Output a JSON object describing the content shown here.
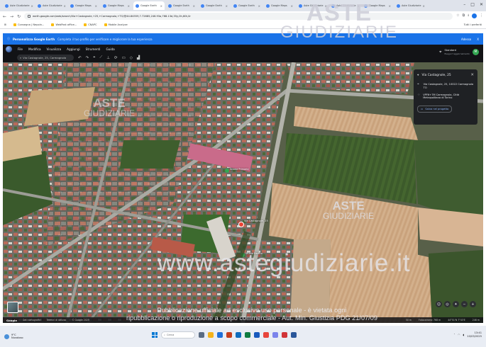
{
  "browser": {
    "tabs": [
      {
        "label": "Aste Giudiziarie",
        "active": false
      },
      {
        "label": "Aste Giudiziarie",
        "active": false
      },
      {
        "label": "Google Maps",
        "active": false
      },
      {
        "label": "Google Maps",
        "active": false
      },
      {
        "label": "Google Earth",
        "active": true
      },
      {
        "label": "Google Earth",
        "active": false
      },
      {
        "label": "Google Earth",
        "active": false
      },
      {
        "label": "Google Earth",
        "active": false
      },
      {
        "label": "Google Maps",
        "active": false
      },
      {
        "label": "Aste Giudiziarie",
        "active": false
      },
      {
        "label": "Aste Giudiziarie",
        "active": false
      },
      {
        "label": "Google Maps",
        "active": false
      },
      {
        "label": "Aste Giudiziarie",
        "active": false
      }
    ],
    "url": "earth.google.com/web/search/Via+Castagnole,+25,+Carmagnola,+TO/@44.84559,7.72685,246.93a,768.13d,35y,0h,60t,0r",
    "bookmarks": [
      "Consegna | Nepoin...",
      "WebPost office...",
      "CNAPC",
      "Mobile Analyze"
    ],
    "bookmarks_right": "Tutti i preferiti"
  },
  "banner": {
    "title": "Personalizza Google Earth",
    "message": "Completa il tuo profilo per verificare e migliorare la tua esperienza",
    "actions": [
      "Adesso",
      "X"
    ]
  },
  "earth": {
    "menu": [
      "File",
      "Modifica",
      "Visualizza",
      "Aggiungi",
      "Strumenti",
      "Guida"
    ],
    "search_value": "Via Castagnole, 25, Carmagnola",
    "account": {
      "name": "Standard",
      "sub": "Esegui l'aggiornamento",
      "initial": "M"
    },
    "place_panel": {
      "title": "Via Castagnole, 25",
      "address": "Via Castagnole, 25, 10022 Carmagnola TO",
      "plus_code": "VPF6+7M Carmagnola, Città Metropolitana di Torino",
      "save_label": "Salva nel progetto"
    },
    "map_labels": [
      {
        "text": "Via Castagnole, 25"
      },
      {
        "text": "Scuola Primaria"
      },
      {
        "text": "Studio Medico"
      }
    ],
    "status": {
      "logo": "Google",
      "left": [
        "Dati cartografici",
        "Termini di utilizzo",
        "© Google 2025"
      ],
      "right": [
        "50 m",
        "Fotocamera: 768 m",
        "44°51'N 7°43'E",
        "246 m"
      ]
    }
  },
  "watermarks": {
    "aste_line1": "ASTE",
    "aste_line2": "GIUDIZIARIE",
    "site": "www.astegiudiziarie.it",
    "disclaimer_line1": "Pubblicazione ufficiale ad esclusivo uso personale - è vietata ogni",
    "disclaimer_line2": "ripubblicazione o riproduzione a scopo commerciale - Aut. Min. Giustizia PDG 21/07/09"
  },
  "taskbar": {
    "weather": {
      "temp": "9°C",
      "desc": "Nuvoloso"
    },
    "search_placeholder": "Cerca",
    "clock": {
      "time": "13:41",
      "date": "10/03/2025"
    }
  },
  "colors": {
    "brand_blue": "#1a73e8",
    "map_bg": "#4b5640"
  }
}
